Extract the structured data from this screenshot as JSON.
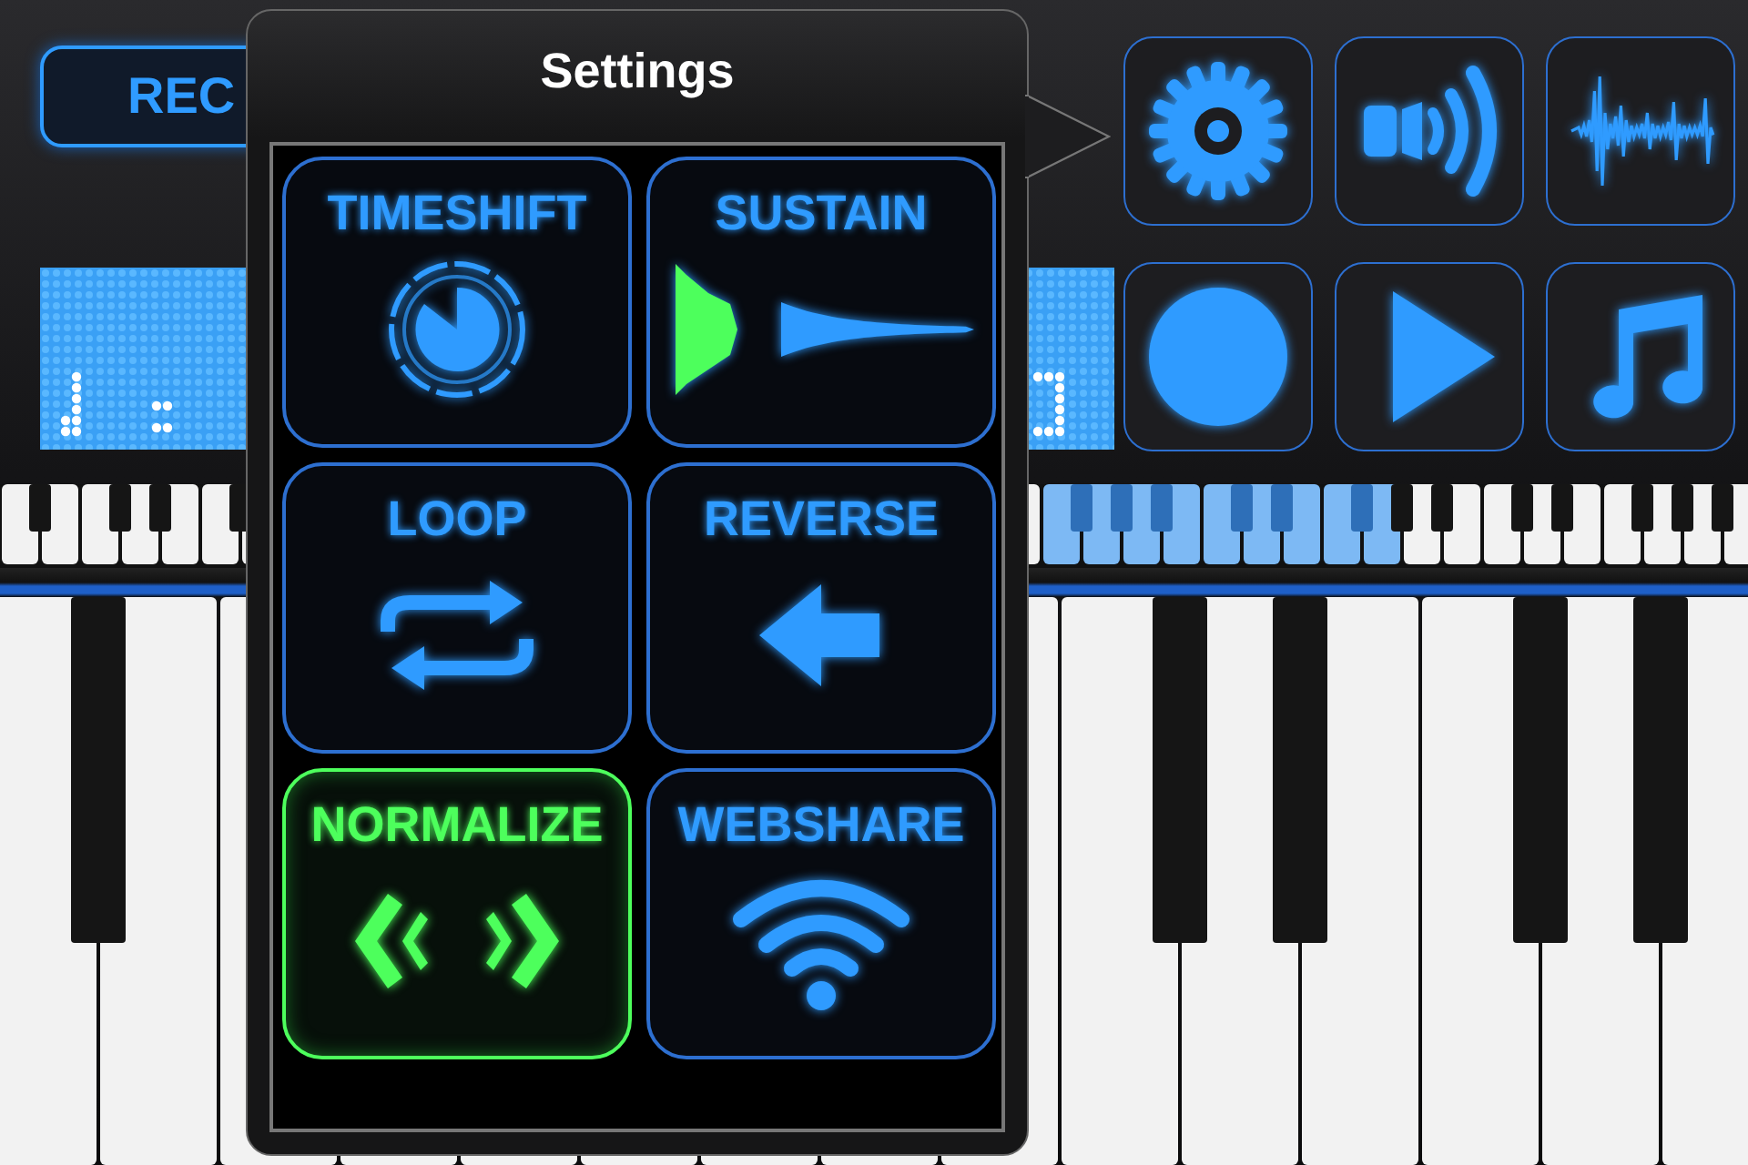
{
  "record_button": {
    "label": "REC"
  },
  "toolbar": {
    "buttons": [
      {
        "kind": "gear"
      },
      {
        "kind": "speaker"
      },
      {
        "kind": "waveform"
      },
      {
        "kind": "record"
      },
      {
        "kind": "play"
      },
      {
        "kind": "note"
      }
    ]
  },
  "settings_popover": {
    "title": "Settings",
    "options": [
      {
        "label": "TIMESHIFT",
        "kind": "timeshift",
        "selected": false
      },
      {
        "label": "SUSTAIN",
        "kind": "sustain",
        "selected": false
      },
      {
        "label": "LOOP",
        "kind": "loop",
        "selected": false
      },
      {
        "label": "REVERSE",
        "kind": "reverse",
        "selected": false
      },
      {
        "label": "NORMALIZE",
        "kind": "normalize",
        "selected": true
      },
      {
        "label": "WEBSHARE",
        "kind": "webshare",
        "selected": false
      }
    ]
  }
}
